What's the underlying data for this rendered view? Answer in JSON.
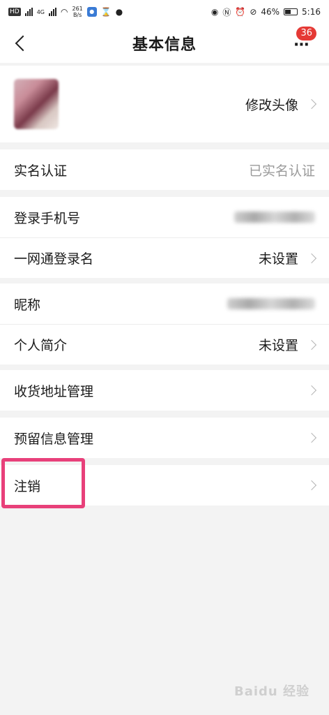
{
  "status_bar": {
    "hd_tag": "HD",
    "net_speed_value": "261",
    "net_speed_unit": "B/s",
    "network_tag": "4G",
    "battery": "46%",
    "time": "5:16"
  },
  "header": {
    "title": "基本信息",
    "badge_count": "36"
  },
  "avatar_row": {
    "label": "修改头像"
  },
  "rows": {
    "real_name": {
      "label": "实名认证",
      "value": "已实名认证"
    },
    "phone": {
      "label": "登录手机号"
    },
    "login_name": {
      "label": "一网通登录名",
      "value": "未设置"
    },
    "nickname": {
      "label": "昵称"
    },
    "bio": {
      "label": "个人简介",
      "value": "未设置"
    },
    "address": {
      "label": "收货地址管理"
    },
    "reserved": {
      "label": "预留信息管理"
    },
    "logout": {
      "label": "注销"
    }
  },
  "watermark": "Baidu 经验",
  "colors": {
    "highlight": "#e8407a",
    "badge": "#e53935",
    "background": "#f3f3f3"
  }
}
